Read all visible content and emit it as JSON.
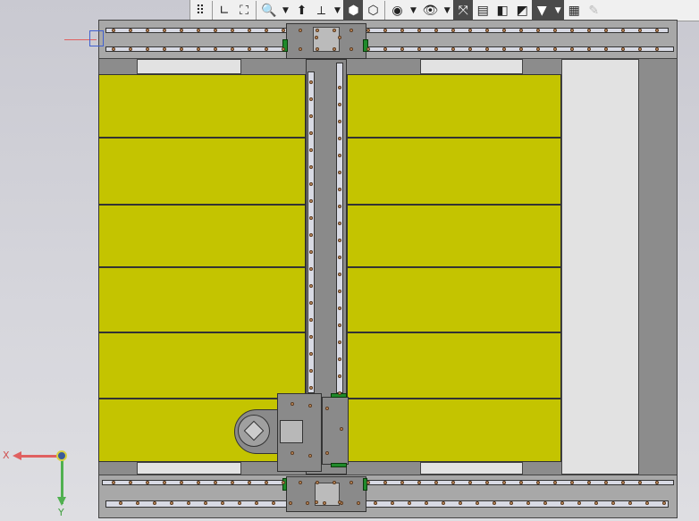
{
  "toolbar": {
    "items": [
      {
        "icon": "grip-icon",
        "glyph": "⠿"
      },
      {
        "icon": "sketch-icon",
        "glyph": "∟"
      },
      {
        "icon": "view-orientation-icon",
        "glyph": "⛶"
      },
      {
        "icon": "zoom-area-icon",
        "glyph": "🔍"
      },
      {
        "icon": "standard-views-icon",
        "glyph": "⬆"
      },
      {
        "icon": "triad-icon",
        "glyph": "⟂"
      },
      {
        "icon": "shaded-icon",
        "glyph": "⬢"
      },
      {
        "icon": "wireframe-icon",
        "glyph": "⬡"
      },
      {
        "icon": "hide-show-icon",
        "glyph": "◉"
      },
      {
        "icon": "display-mode-icon",
        "glyph": "👁"
      },
      {
        "icon": "section-view-icon",
        "glyph": "⤧"
      },
      {
        "icon": "exploded-view-icon",
        "glyph": "▤"
      },
      {
        "icon": "appearance-icon",
        "glyph": "◧"
      },
      {
        "icon": "scene-icon",
        "glyph": "◩"
      },
      {
        "icon": "filter-icon",
        "glyph": "▼"
      },
      {
        "icon": "measure-icon",
        "glyph": "▦"
      },
      {
        "icon": "eyedropper-icon",
        "glyph": "✎"
      }
    ]
  },
  "triad": {
    "x_label": "X",
    "y_label": "Y"
  },
  "colors": {
    "panel": "#c4c400",
    "frame": "#8c8c8c",
    "x_axis": "#e05050",
    "y_axis": "#40b040"
  }
}
